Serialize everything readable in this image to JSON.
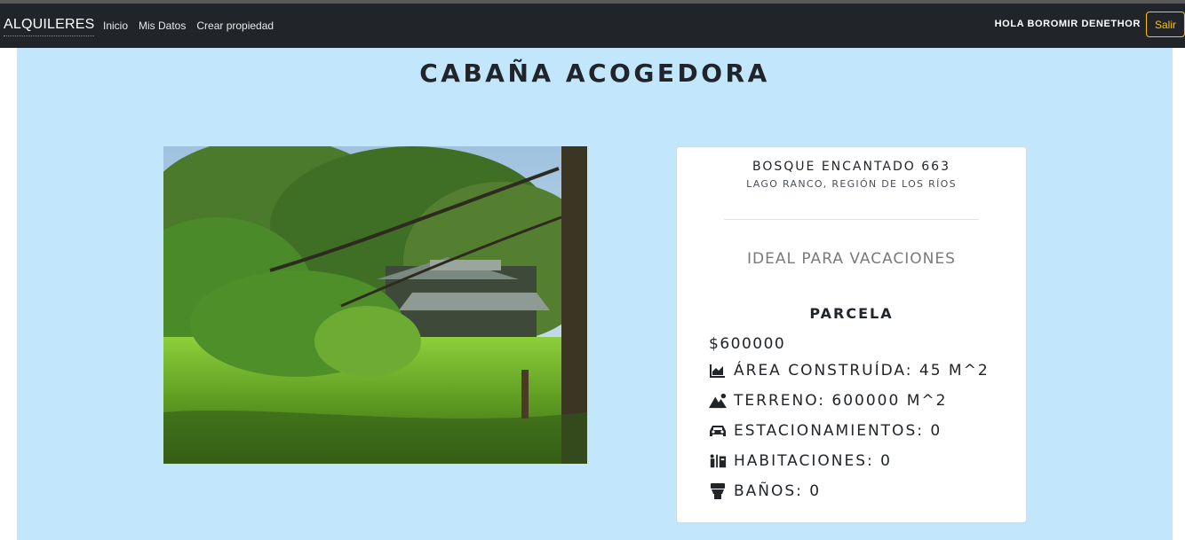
{
  "navbar": {
    "brand": "ALQUILERES",
    "links": [
      "Inicio",
      "Mis Datos",
      "Crear propiedad"
    ],
    "greeting": "HOLA BOROMIR DENETHOR",
    "logout_label": "Salir"
  },
  "property": {
    "title": "CABAÑA ACOGEDORA",
    "address": "BOSQUE ENCANTADO 663",
    "location": "LAGO RANCO, REGIÓN DE LOS RÍOS",
    "tagline": "IDEAL PARA VACACIONES",
    "type": "PARCELA",
    "price": "$600000",
    "features": [
      {
        "icon": "area-chart-icon",
        "label": "ÁREA CONSTRUÍDA: 45 M^2"
      },
      {
        "icon": "mountain-icon",
        "label": "TERRENO: 600000 M^2"
      },
      {
        "icon": "car-icon",
        "label": "ESTACIONAMIENTOS: 0"
      },
      {
        "icon": "people-icon",
        "label": "HABITACIONES: 0"
      },
      {
        "icon": "toilet-icon",
        "label": "BAÑOS: 0"
      }
    ]
  },
  "colors": {
    "navbar_bg": "#212529",
    "page_bg": "#c2e6fb",
    "logout_accent": "#ffc107"
  }
}
